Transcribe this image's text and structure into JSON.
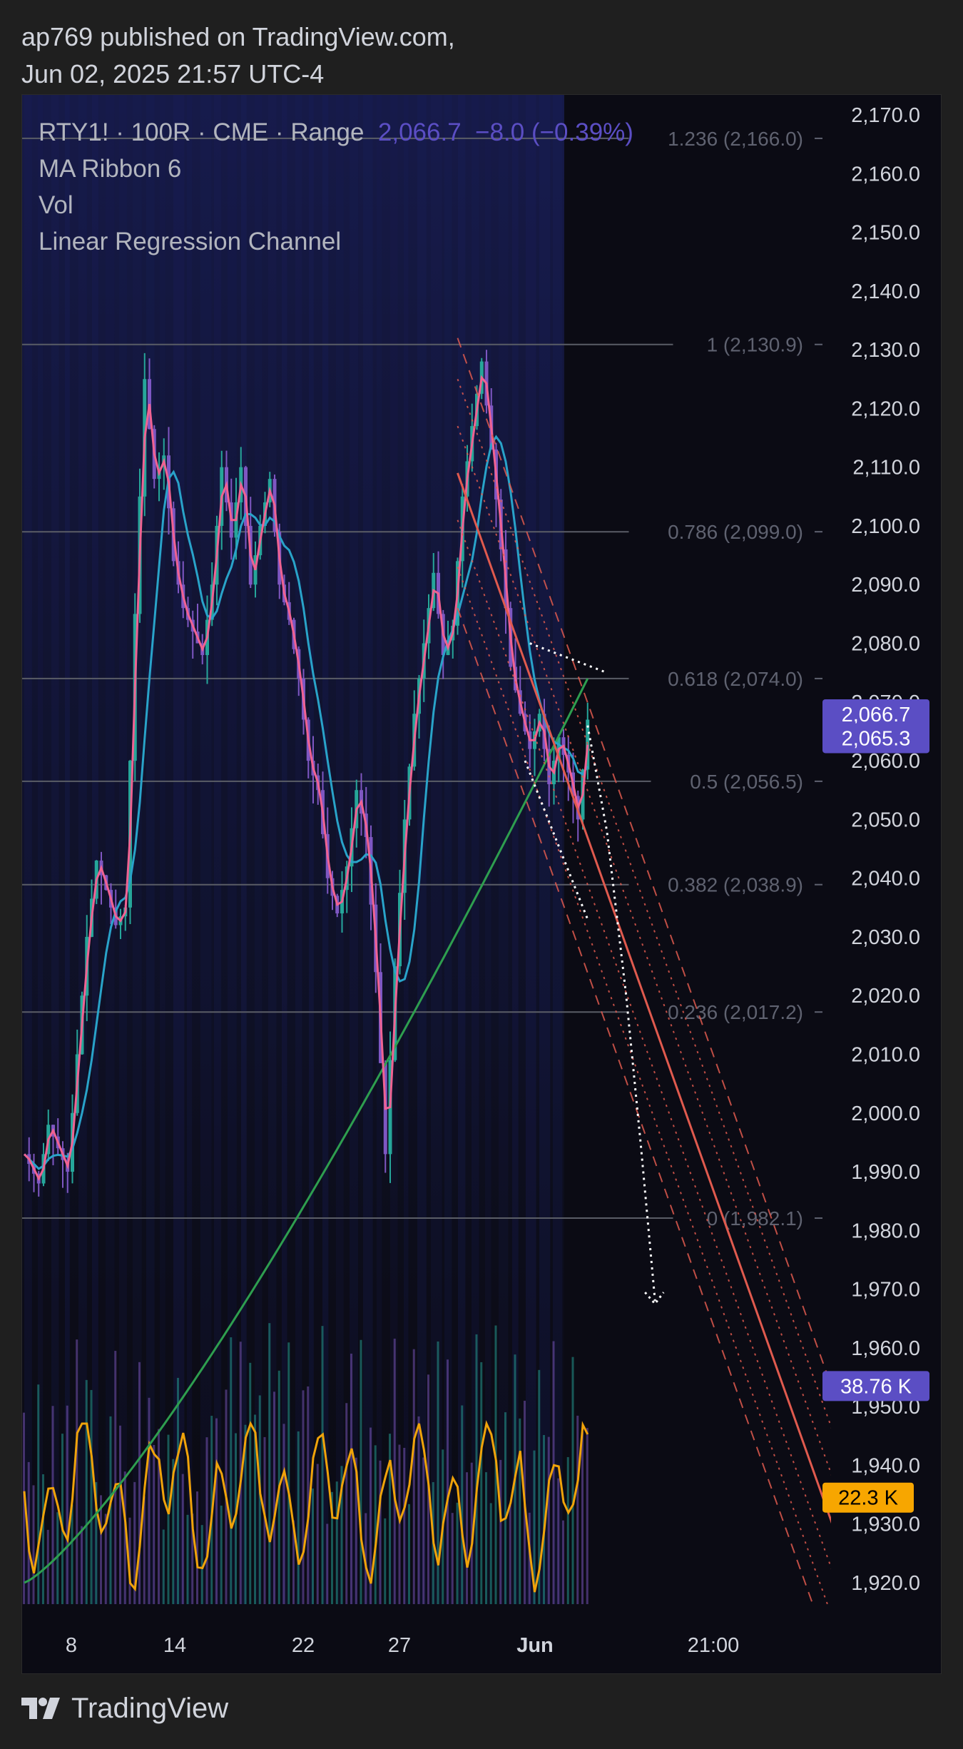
{
  "header": {
    "line1": "ap769 published on TradingView.com,",
    "line2": "Jun 02, 2025 21:57 UTC-4"
  },
  "legend": {
    "symbol": "RTY1! · 100R · CME · Range",
    "price": "2,066.7",
    "change": "−8.0 (−0.39%)",
    "indicators": [
      "MA Ribbon 6",
      "Vol",
      "Linear Regression Channel"
    ]
  },
  "footer": {
    "brand": "TradingView",
    "logo_icon": "tradingview-logo-icon"
  },
  "colors": {
    "background": "#0b0b14",
    "candle_up": "#26a69a",
    "candle_down": "#7e57c2",
    "ma_fast": "#f06292",
    "ma_mid": "#29a3c9",
    "ma_slow": "#2e9e4f",
    "volume_ma": "#f0a30a",
    "regression": "#e05a4e",
    "fib_line": "#5a5d66",
    "badge_price": "#5b4ec4",
    "badge_volume_ma": "#f7a600"
  },
  "chart_data": {
    "type": "candlestick",
    "symbol": "RTY1!",
    "timeframe": "100R",
    "exchange": "CME",
    "chart_style": "Range",
    "last_price": 2066.7,
    "change": -8.0,
    "change_pct": -0.39,
    "ylim": [
      1915,
      2172
    ],
    "y_ticks": [
      "2,170.0",
      "2,160.0",
      "2,150.0",
      "2,140.0",
      "2,130.0",
      "2,120.0",
      "2,110.0",
      "2,100.0",
      "2,090.0",
      "2,080.0",
      "2,070.0",
      "2,060.0",
      "2,050.0",
      "2,040.0",
      "2,030.0",
      "2,020.0",
      "2,010.0",
      "2,000.0",
      "1,990.0",
      "1,980.0",
      "1,970.0",
      "1,960.0",
      "1,950.0",
      "1,940.0",
      "1,930.0",
      "1,920.0"
    ],
    "x_ticks": [
      "8",
      "14",
      "22",
      "27",
      "Jun",
      "21:00"
    ],
    "fib_levels": [
      {
        "label": "1.236 (2,166.0)",
        "value": 2166.0
      },
      {
        "label": "1 (2,130.9)",
        "value": 2130.9
      },
      {
        "label": "0.786 (2,099.0)",
        "value": 2099.0
      },
      {
        "label": "0.618 (2,074.0)",
        "value": 2074.0
      },
      {
        "label": "0.5 (2,056.5)",
        "value": 2056.5
      },
      {
        "label": "0.382 (2,038.9)",
        "value": 2038.9
      },
      {
        "label": "0.236 (2,017.2)",
        "value": 2017.2
      },
      {
        "label": "0 (1,982.1)",
        "value": 1982.1
      }
    ],
    "price_path": [
      [
        0,
        1993
      ],
      [
        3,
        1988
      ],
      [
        5,
        1998
      ],
      [
        7,
        1994
      ],
      [
        9,
        1990
      ],
      [
        11,
        2010
      ],
      [
        13,
        2030
      ],
      [
        15,
        2043
      ],
      [
        17,
        2038
      ],
      [
        19,
        2032
      ],
      [
        21,
        2035
      ],
      [
        23,
        2085
      ],
      [
        25,
        2125
      ],
      [
        27,
        2108
      ],
      [
        29,
        2112
      ],
      [
        31,
        2094
      ],
      [
        33,
        2086
      ],
      [
        35,
        2082
      ],
      [
        37,
        2078
      ],
      [
        39,
        2090
      ],
      [
        41,
        2110
      ],
      [
        43,
        2098
      ],
      [
        45,
        2110
      ],
      [
        47,
        2090
      ],
      [
        49,
        2100
      ],
      [
        51,
        2108
      ],
      [
        53,
        2090
      ],
      [
        55,
        2084
      ],
      [
        57,
        2074
      ],
      [
        59,
        2060
      ],
      [
        61,
        2055
      ],
      [
        63,
        2040
      ],
      [
        65,
        2034
      ],
      [
        67,
        2042
      ],
      [
        69,
        2055
      ],
      [
        71,
        2047
      ],
      [
        73,
        2024
      ],
      [
        75,
        1993
      ],
      [
        77,
        2025
      ],
      [
        79,
        2050
      ],
      [
        81,
        2068
      ],
      [
        83,
        2080
      ],
      [
        85,
        2092
      ],
      [
        87,
        2078
      ],
      [
        89,
        2083
      ],
      [
        91,
        2105
      ],
      [
        93,
        2117
      ],
      [
        95,
        2128
      ],
      [
        97,
        2113
      ],
      [
        99,
        2096
      ],
      [
        101,
        2076
      ],
      [
        103,
        2068
      ],
      [
        105,
        2062
      ],
      [
        107,
        2068
      ],
      [
        109,
        2056
      ],
      [
        111,
        2064
      ],
      [
        113,
        2058
      ],
      [
        115,
        2050
      ],
      [
        117,
        2067
      ]
    ],
    "regression_channel": {
      "start": {
        "index": 90,
        "center": 2109.0
      },
      "end": {
        "index": 170,
        "center": 1925.0
      },
      "offsets": [
        23,
        16,
        8,
        -8,
        -16,
        -23
      ]
    },
    "projection_path": [
      [
        117,
        2066
      ],
      [
        121,
        2048
      ],
      [
        125,
        2020
      ],
      [
        128,
        1995
      ],
      [
        131,
        1968
      ]
    ],
    "series": [
      {
        "name": "MA Ribbon 6"
      },
      {
        "name": "Vol"
      },
      {
        "name": "Linear Regression Channel"
      }
    ],
    "badges": [
      {
        "text": "2,066.7",
        "value": 2066.7,
        "color": "#5b4ec4"
      },
      {
        "text": "2,065.3",
        "value": 2065.3,
        "color": "#5b4ec4"
      },
      {
        "text": "38.76 K",
        "value": 1953.5,
        "color": "#5b4ec4"
      },
      {
        "text": "22.3 K",
        "value": 1934.5,
        "color": "#f7a600"
      }
    ]
  }
}
